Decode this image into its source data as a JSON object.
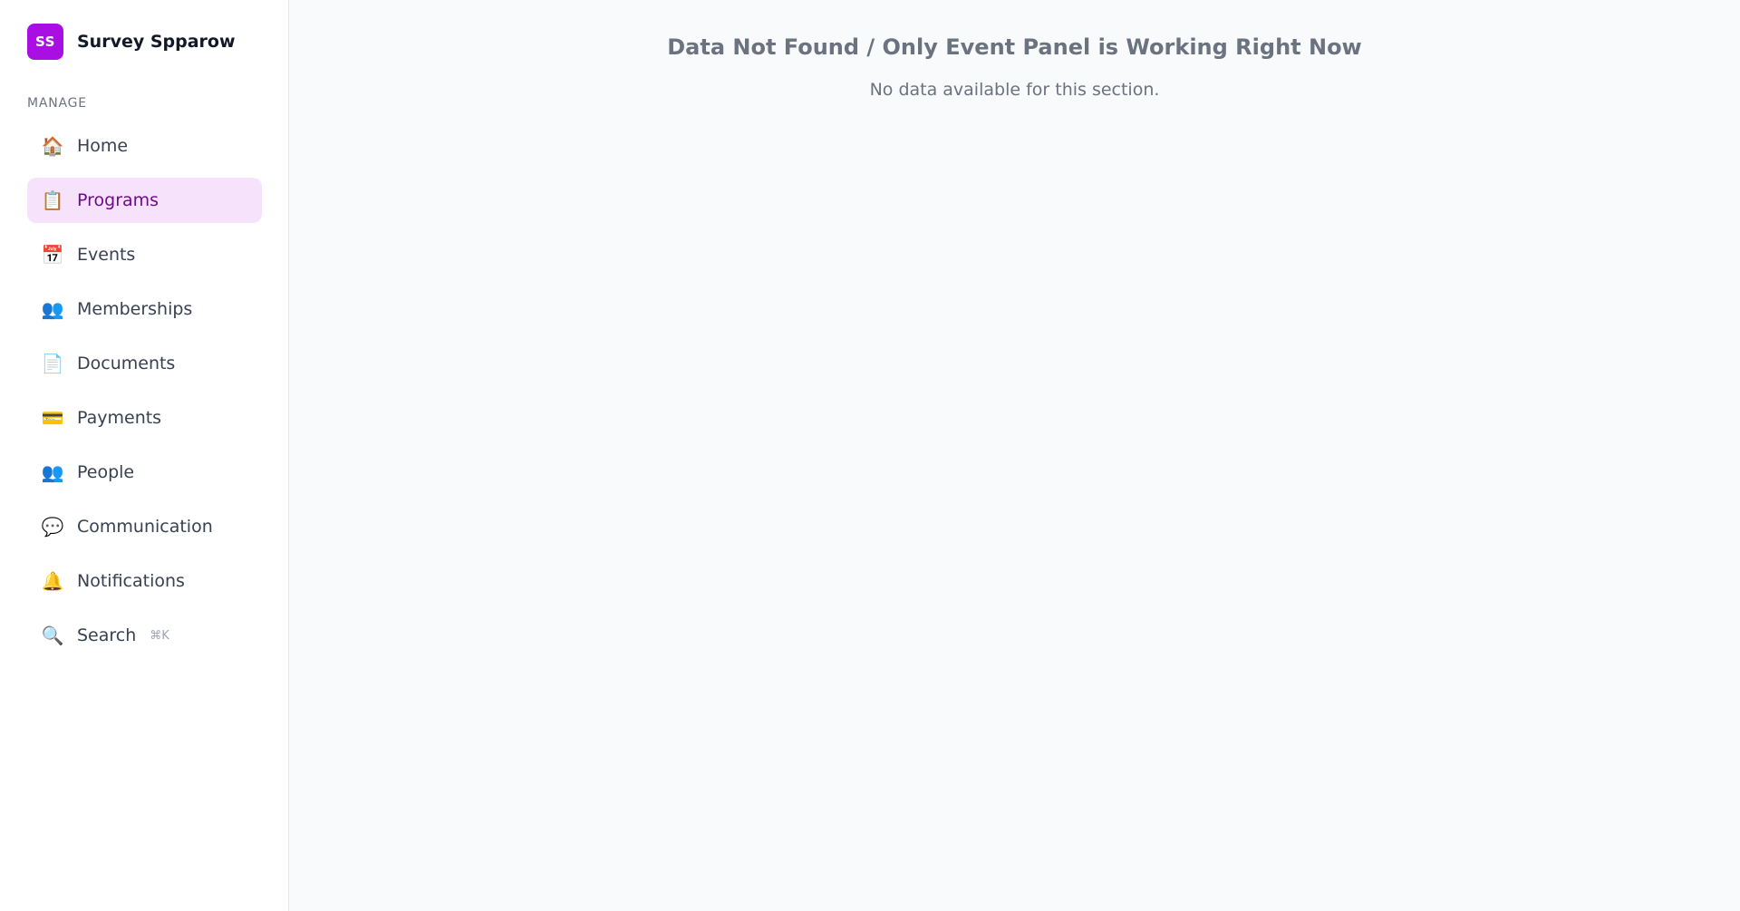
{
  "brand": {
    "initials": "SS",
    "name": "Survey Spparow",
    "color": "#a90fe3"
  },
  "sidebar": {
    "section_label": "MANAGE",
    "items": [
      {
        "label": "Home",
        "icon": "house-icon",
        "glyph": "🏠",
        "active": false
      },
      {
        "label": "Programs",
        "icon": "clipboard-icon",
        "glyph": "📋",
        "active": true
      },
      {
        "label": "Events",
        "icon": "calendar-icon",
        "glyph": "📅",
        "active": false
      },
      {
        "label": "Memberships",
        "icon": "people-icon",
        "glyph": "👥",
        "active": false
      },
      {
        "label": "Documents",
        "icon": "document-icon",
        "glyph": "📄",
        "active": false
      },
      {
        "label": "Payments",
        "icon": "credit-card-icon",
        "glyph": "💳",
        "active": false
      },
      {
        "label": "People",
        "icon": "people-icon",
        "glyph": "👥",
        "active": false
      },
      {
        "label": "Communication",
        "icon": "speech-bubble-icon",
        "glyph": "💬",
        "active": false
      },
      {
        "label": "Notifications",
        "icon": "bell-icon",
        "glyph": "🔔",
        "active": false
      },
      {
        "label": "Search",
        "icon": "search-icon",
        "glyph": "🔍",
        "active": false,
        "shortcut": "⌘K"
      }
    ]
  },
  "main": {
    "title": "Data Not Found / Only Event Panel is Working Right Now",
    "subtitle": "No data available for this section."
  }
}
